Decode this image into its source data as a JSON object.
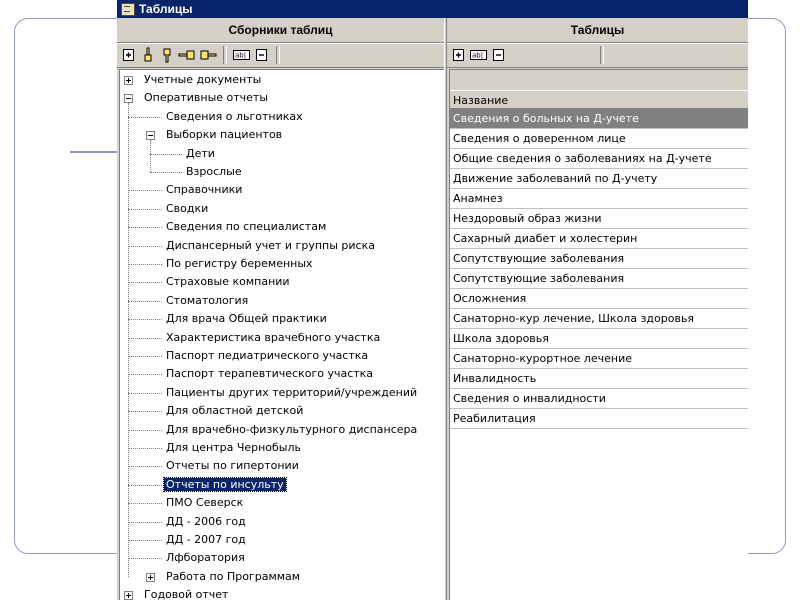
{
  "window": {
    "title": "Таблицы"
  },
  "left_panel": {
    "header": "Сборники таблиц",
    "tree": [
      {
        "label": "Учетные документы",
        "level": 0,
        "expander": "plus"
      },
      {
        "label": "Оперативные отчеты",
        "level": 0,
        "expander": "minus"
      },
      {
        "label": "Сведения о льготниках",
        "level": 1
      },
      {
        "label": "Выборки пациентов",
        "level": 1,
        "expander": "minus"
      },
      {
        "label": "Дети",
        "level": 2
      },
      {
        "label": "Взрослые",
        "level": 2
      },
      {
        "label": "Справочники",
        "level": 1
      },
      {
        "label": "Сводки",
        "level": 1
      },
      {
        "label": "Сведения по специалистам",
        "level": 1
      },
      {
        "label": "Диспансерный учет и группы риска",
        "level": 1
      },
      {
        "label": "По регистру беременных",
        "level": 1
      },
      {
        "label": "Страховые компании",
        "level": 1
      },
      {
        "label": "Стоматология",
        "level": 1
      },
      {
        "label": "Для врача Общей практики",
        "level": 1
      },
      {
        "label": "Характеристика врачебного участка",
        "level": 1
      },
      {
        "label": "Паспорт педиатрического участка",
        "level": 1
      },
      {
        "label": "Паспорт терапевтического участка",
        "level": 1
      },
      {
        "label": "Пациенты других территорий/учреждений",
        "level": 1
      },
      {
        "label": "Для областной детской",
        "level": 1
      },
      {
        "label": "Для врачебно-физкультурного диспансера",
        "level": 1
      },
      {
        "label": "Для центра Чернобыль",
        "level": 1
      },
      {
        "label": "Отчеты по гипертонии",
        "level": 1
      },
      {
        "label": "Отчеты по инсульту",
        "level": 1,
        "selected": true
      },
      {
        "label": "ПМО Северск",
        "level": 1
      },
      {
        "label": "ДД - 2006 год",
        "level": 1
      },
      {
        "label": "ДД - 2007 год",
        "level": 1
      },
      {
        "label": "Лфборатория",
        "level": 1
      },
      {
        "label": "Работа по Программам",
        "level": 1,
        "expander": "plus"
      },
      {
        "label": "Годовой отчет",
        "level": 0,
        "expander": "plus"
      }
    ]
  },
  "right_panel": {
    "header": "Таблицы",
    "column_header": "Название",
    "rows": [
      {
        "label": "Сведения о больных на Д-учете",
        "selected": true
      },
      {
        "label": "Сведения о доверенном лице"
      },
      {
        "label": "Общие сведения о заболеваниях на Д-учете"
      },
      {
        "label": "Движение заболеваний по Д-учету"
      },
      {
        "label": "Анамнез"
      },
      {
        "label": "Нездоровый образ жизни"
      },
      {
        "label": "Сахарный диабет и холестерин"
      },
      {
        "label": "Сопутствующие заболевания"
      },
      {
        "label": "Сопутствующие заболевания"
      },
      {
        "label": "Осложнения"
      },
      {
        "label": "Санаторно-кур лечение, Школа здоровья"
      },
      {
        "label": "Школа здоровья"
      },
      {
        "label": "Санаторно-курортное лечение"
      },
      {
        "label": "Инвалидность"
      },
      {
        "label": "Сведения о инвалидности"
      },
      {
        "label": "Реабилитация"
      }
    ]
  },
  "toolbar_icons": {
    "left": [
      "add-icon",
      "hand-up-icon",
      "hand-down-icon",
      "hand-left-icon",
      "hand-right-icon",
      "rename-icon",
      "delete-icon"
    ],
    "right": [
      "add-icon",
      "rename-icon",
      "delete-icon"
    ]
  },
  "colors": {
    "titlebar": "#0a246a",
    "face": "#d4d0c8",
    "selection": "#0a246a",
    "grid_selection": "#808080",
    "frame": "#8f98c2"
  }
}
